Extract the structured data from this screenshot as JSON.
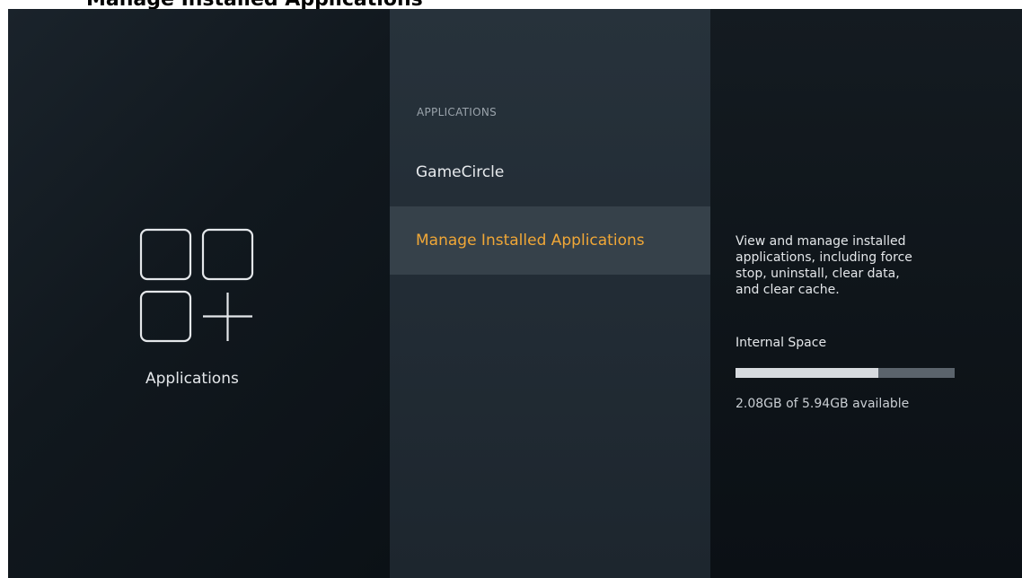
{
  "top_cut_title": "Manage Installed Applications",
  "category": {
    "label": "Applications",
    "icon": "apps-grid-plus-icon"
  },
  "menu": {
    "header": "APPLICATIONS",
    "items": [
      {
        "label": "GameCircle",
        "selected": false
      },
      {
        "label": "Manage Installed Applications",
        "selected": true
      }
    ]
  },
  "details": {
    "description": "View and manage installed\napplications, including force\nstop, uninstall, clear data,\nand clear cache.",
    "storage": {
      "label": "Internal Space",
      "available_text": "2.08GB of 5.94GB available",
      "used_fraction": 0.65
    }
  },
  "colors": {
    "accent": "#f0a737",
    "selected_bg": "#36414a",
    "text": "#e4e7ea"
  }
}
